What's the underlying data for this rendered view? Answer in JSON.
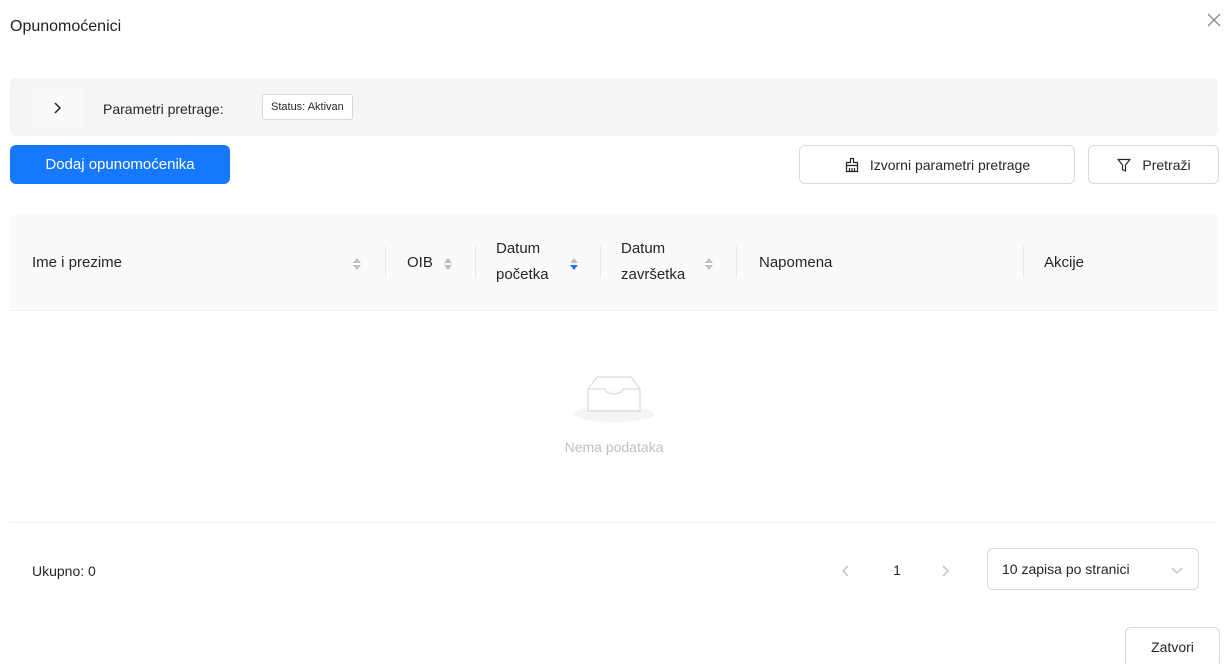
{
  "modal": {
    "title": "Opunomoćenici",
    "close_icon": "close-icon"
  },
  "search_params": {
    "label": "Parametri pretrage:",
    "tags": [
      "Status: Aktivan"
    ],
    "expand_icon": "chevron-right-icon"
  },
  "toolbar": {
    "add_label": "Dodaj opunomoćenika",
    "reset_label": "Izvorni parametri pretrage",
    "reset_icon": "clear-icon",
    "search_label": "Pretraži",
    "search_icon": "filter-icon"
  },
  "table": {
    "columns": [
      {
        "line1": "Ime i prezime",
        "line2": "",
        "sort": "none"
      },
      {
        "line1": "OIB",
        "line2": "",
        "sort": "none"
      },
      {
        "line1": "Datum",
        "line2": "početka",
        "sort": "descending"
      },
      {
        "line1": "Datum",
        "line2": "završetka",
        "sort": "none"
      },
      {
        "line1": "Napomena",
        "line2": "",
        "sort": null
      },
      {
        "line1": "Akcije",
        "line2": "",
        "sort": null
      }
    ],
    "rows": [],
    "empty_text": "Nema podataka",
    "empty_icon": "empty-inbox-icon"
  },
  "pagination": {
    "total_label": "Ukupno: 0",
    "current_page": "1",
    "page_size_label": "10 zapisa po stranici"
  },
  "footer": {
    "close_label": "Zatvori"
  },
  "colors": {
    "primary": "#1677ff",
    "border": "#d9d9d9",
    "header_bg": "#fafafa",
    "sort_active": "#1677ff",
    "sort_inactive": "#bfbfbf"
  }
}
